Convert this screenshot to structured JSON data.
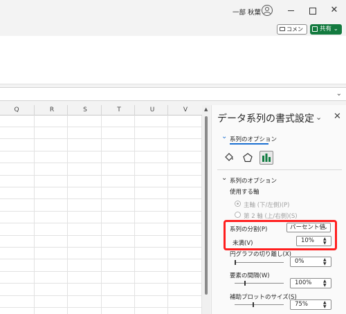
{
  "titlebar": {
    "user_name": "一部 秋葉"
  },
  "share_row": {
    "comment_label": "コメント",
    "share_label": "共有 ⌄"
  },
  "sheet": {
    "columns": [
      "Q",
      "R",
      "S",
      "T",
      "U",
      "V"
    ]
  },
  "pane": {
    "title": "データ系列の書式設定",
    "tab_label": "系列のオプション",
    "section_title": "系列のオプション",
    "axis_label": "使用する軸",
    "primary_axis": "主軸 (下/左側)(P)",
    "secondary_axis": "第 2 軸 (上/右側)(S)",
    "split_by_label": "系列の分割(P)",
    "split_by_value": "パーセント値",
    "less_than_label": "未満(V)",
    "less_than_value": "10%",
    "pie_explosion_label": "円グラフの切り離し(X)",
    "pie_explosion_value": "0%",
    "gap_width_label": "要素の間隔(W)",
    "gap_width_value": "100%",
    "plot_size_label": "補助プロットのサイズ(S)",
    "plot_size_value": "75%"
  },
  "colors": {
    "accent": "#1a6fd1",
    "share_green": "#137a3f",
    "highlight": "#ff1e1e"
  }
}
